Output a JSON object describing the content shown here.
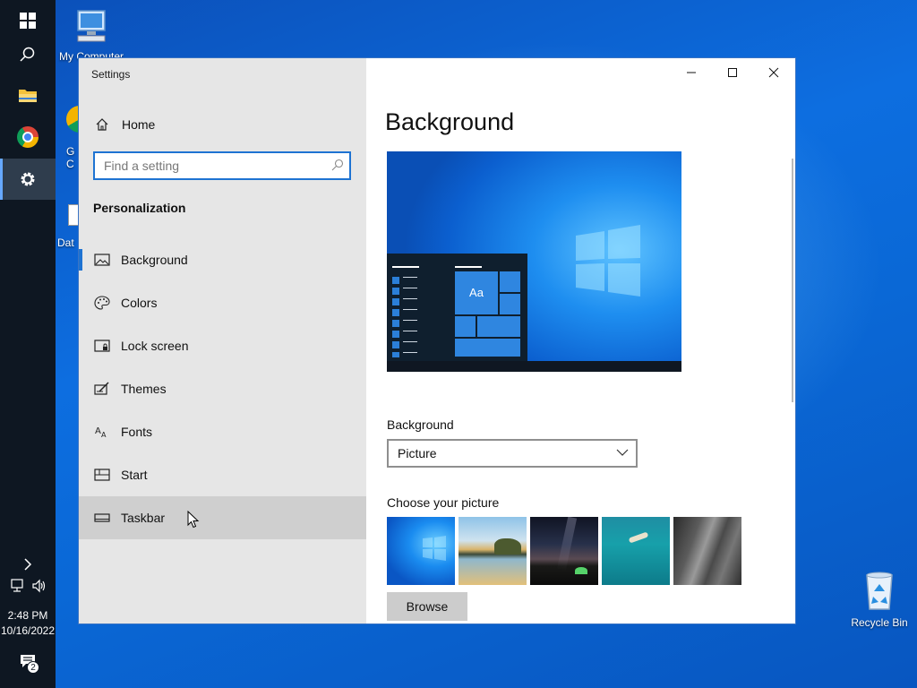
{
  "window": {
    "title": "Settings",
    "controls": {
      "minimize": "minimize",
      "maximize": "maximize",
      "close": "close"
    }
  },
  "nav": {
    "home_label": "Home",
    "search_placeholder": "Find a setting",
    "section_title": "Personalization",
    "items": [
      {
        "label": "Background",
        "icon": "picture-icon"
      },
      {
        "label": "Colors",
        "icon": "palette-icon"
      },
      {
        "label": "Lock screen",
        "icon": "lock-screen-icon"
      },
      {
        "label": "Themes",
        "icon": "themes-icon"
      },
      {
        "label": "Fonts",
        "icon": "fonts-icon"
      },
      {
        "label": "Start",
        "icon": "start-icon"
      },
      {
        "label": "Taskbar",
        "icon": "taskbar-icon"
      }
    ]
  },
  "content": {
    "page_title": "Background",
    "preview_tile_text": "Aa",
    "background_label": "Background",
    "background_value": "Picture",
    "choose_label": "Choose your picture",
    "browse_label": "Browse"
  },
  "desktop": {
    "icons": [
      {
        "label": "My Computer"
      },
      {
        "label": "Recycle Bin"
      }
    ],
    "partial_labels": [
      "G",
      "C",
      "Dat"
    ]
  },
  "taskbar": {
    "time": "2:48 PM",
    "date": "10/16/2022",
    "notification_count": "2"
  },
  "colors": {
    "accent": "#1e73d2",
    "nav_bg": "#e6e6e6",
    "taskbar_bg": "#0e1722"
  }
}
